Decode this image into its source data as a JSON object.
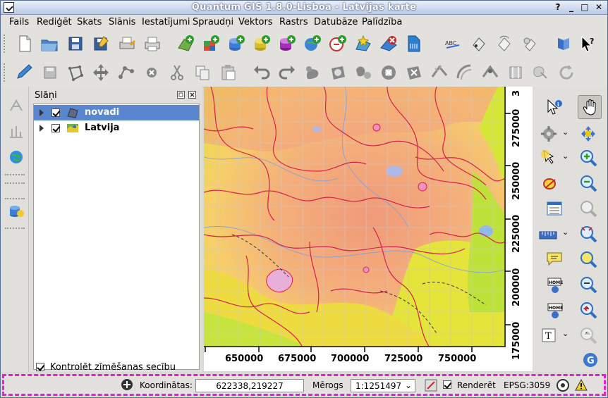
{
  "window": {
    "title": "Quantum GIS 1.8.0-Lisboa - Latvijas karte"
  },
  "menu": [
    "Fails",
    "Rediģēt",
    "Skats",
    "Slānis",
    "Iestatījumi",
    "Spraudņi",
    "Vektors",
    "Rastrs",
    "Datubāze",
    "Palīdzība"
  ],
  "layers_panel": {
    "title": "Slāņi",
    "layers": [
      {
        "name": "novadi",
        "checked": true,
        "selected": true
      },
      {
        "name": "Latvija",
        "checked": true,
        "selected": false
      }
    ],
    "render_order_label": "Kontrolēt zīmēšanas secību"
  },
  "map": {
    "x_ticks": [
      "650000",
      "675000",
      "700000",
      "725000",
      "750000"
    ],
    "y_ticks": [
      "275000",
      "250000",
      "225000",
      "200000",
      "175000"
    ],
    "y_top_label": "3"
  },
  "status": {
    "coords_label": "Koordinātas:",
    "coords_value": "622338,219227",
    "scale_label": "Mērogs",
    "scale_value": "1:1251497",
    "render_label": "Renderēt",
    "crs": "EPSG:3059"
  }
}
